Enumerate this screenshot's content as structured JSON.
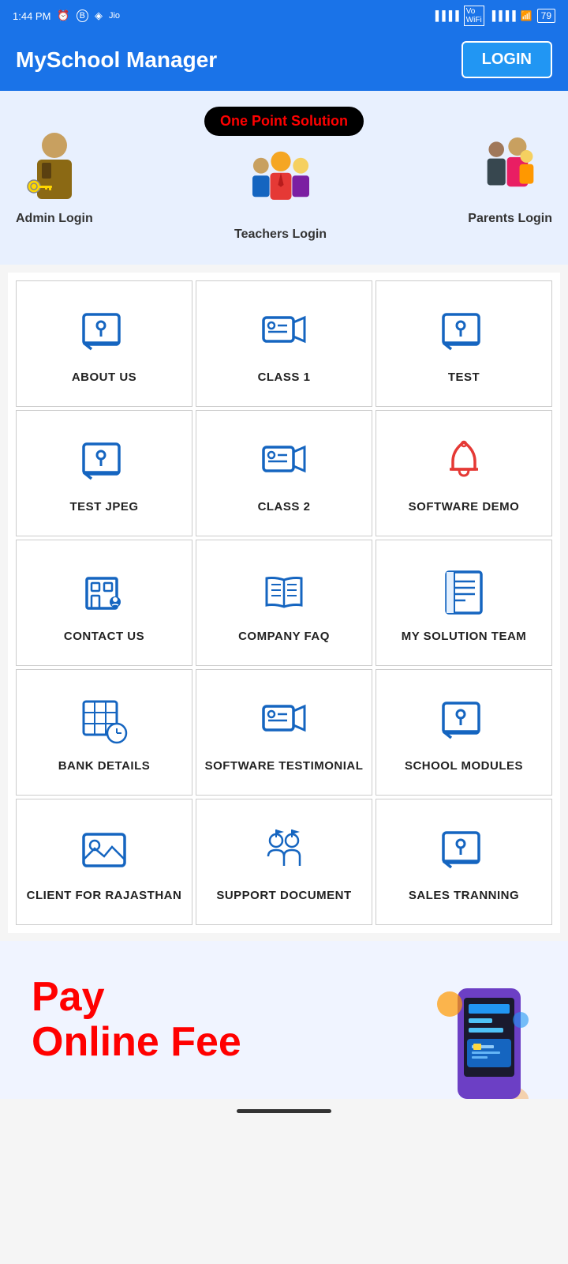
{
  "statusBar": {
    "time": "1:44 PM",
    "battery": "79"
  },
  "header": {
    "title": "MySchool Manager",
    "loginLabel": "LOGIN"
  },
  "banner": {
    "tagline": "One Point Solution",
    "adminLabel": "Admin Login",
    "teachersLabel": "Teachers Login",
    "parentsLabel": "Parents Login"
  },
  "grid": {
    "items": [
      {
        "id": "about-us",
        "label": "ABOUT US",
        "icon": "info-chat"
      },
      {
        "id": "class-1",
        "label": "CLASS 1",
        "icon": "video-camera"
      },
      {
        "id": "test",
        "label": "TEST",
        "icon": "info-chat"
      },
      {
        "id": "test-jpeg",
        "label": "TEST JPEG",
        "icon": "info-chat"
      },
      {
        "id": "class-2",
        "label": "CLASS 2",
        "icon": "video-camera"
      },
      {
        "id": "software-demo",
        "label": "SOFTWARE DEMO",
        "icon": "bell"
      },
      {
        "id": "contact-us",
        "label": "CONTACT US",
        "icon": "building"
      },
      {
        "id": "company-faq",
        "label": "COMPANY FAQ",
        "icon": "book"
      },
      {
        "id": "my-solution-team",
        "label": "MY SOLUTION TEAM",
        "icon": "doc-list"
      },
      {
        "id": "bank-details",
        "label": "BANK DETAILS",
        "icon": "grid-clock"
      },
      {
        "id": "software-testimonial",
        "label": "SOFTWARE TESTIMONIAL",
        "icon": "video-camera"
      },
      {
        "id": "school-modules",
        "label": "SCHOOL MODULES",
        "icon": "info-chat"
      },
      {
        "id": "client-for-rajasthan",
        "label": "CLIENT FOR RAJASTHAN",
        "icon": "image"
      },
      {
        "id": "support-document",
        "label": "SUPPORT DOCUMENT",
        "icon": "people-flags"
      },
      {
        "id": "sales-tranning",
        "label": "SALES TRANNING",
        "icon": "info-chat"
      }
    ]
  },
  "footerBanner": {
    "line1": "Pay",
    "line2": "Online Fee"
  }
}
